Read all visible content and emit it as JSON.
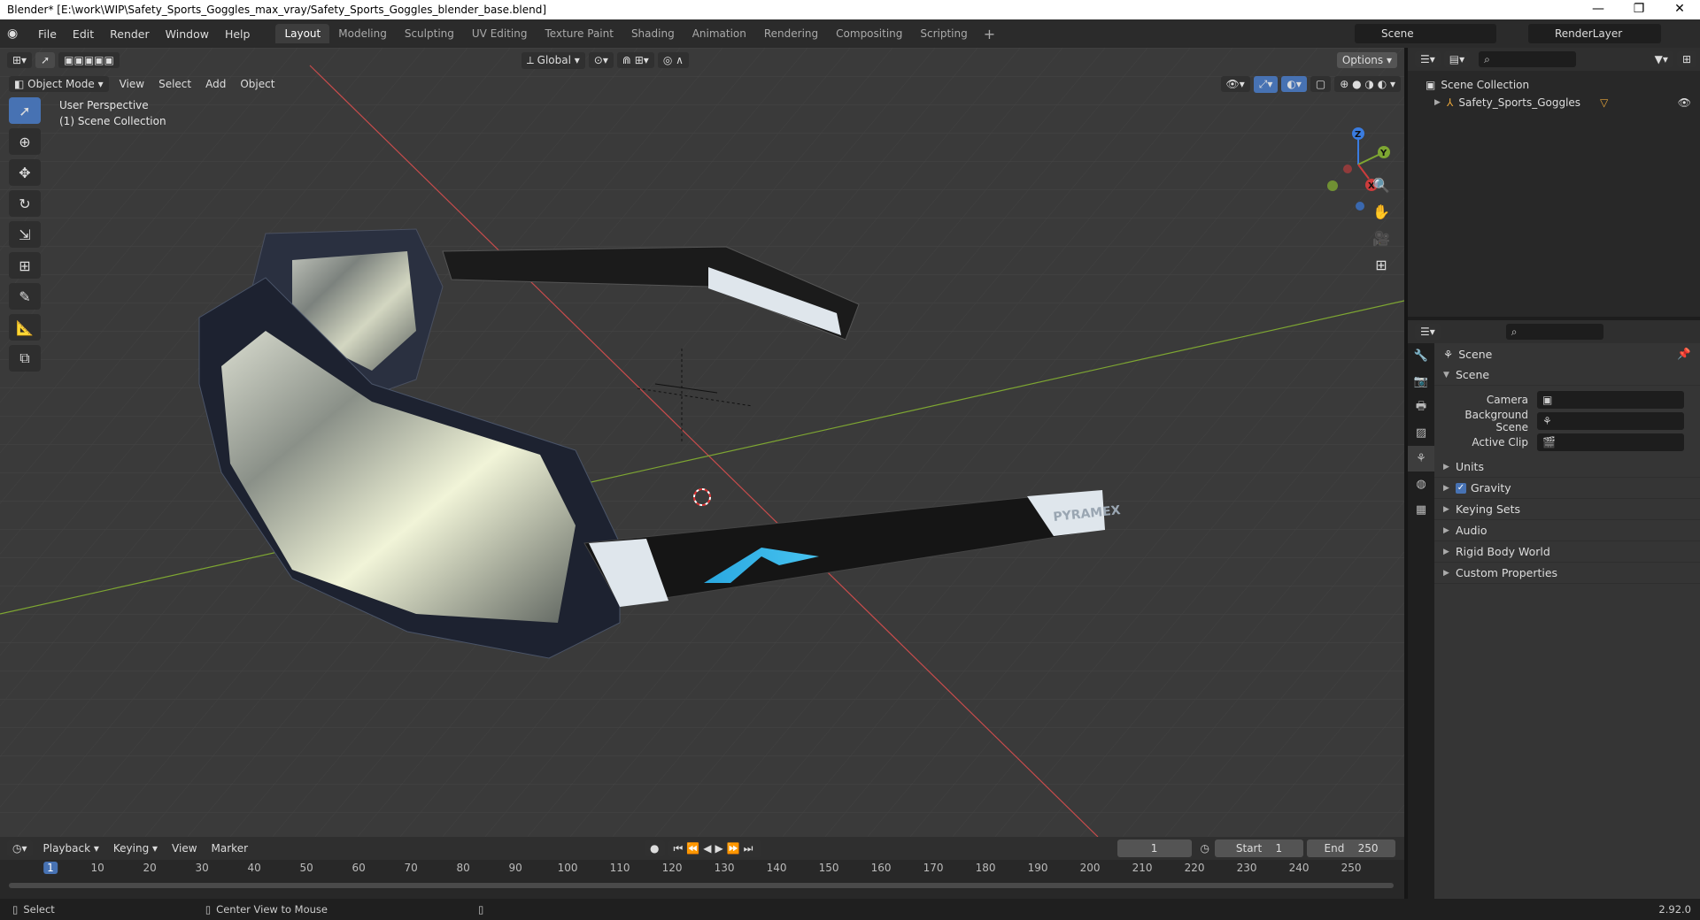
{
  "window": {
    "title": "Blender* [E:\\work\\WIP\\Safety_Sports_Goggles_max_vray/Safety_Sports_Goggles_blender_base.blend]",
    "controls": [
      "—",
      "❐",
      "✕"
    ]
  },
  "topbar": {
    "menus": [
      "File",
      "Edit",
      "Render",
      "Window",
      "Help"
    ],
    "workspaces": [
      "Layout",
      "Modeling",
      "Sculpting",
      "UV Editing",
      "Texture Paint",
      "Shading",
      "Animation",
      "Rendering",
      "Compositing",
      "Scripting"
    ],
    "active_workspace": "Layout",
    "scene_name": "Scene",
    "view_layer": "RenderLayer"
  },
  "viewport": {
    "transform_orientation": "Global",
    "options_label": "Options",
    "mode": "Object Mode",
    "menus": [
      "View",
      "Select",
      "Add",
      "Object"
    ],
    "info_line1": "User Perspective",
    "info_line2": "(1) Scene Collection",
    "brand_text": "PYRAMEX",
    "gizmo": {
      "x": "X",
      "y": "Y",
      "z": "Z"
    }
  },
  "outliner": {
    "root": "Scene Collection",
    "items": [
      {
        "name": "Safety_Sports_Goggles"
      }
    ]
  },
  "properties": {
    "context": "Scene",
    "section": "Scene",
    "fields": [
      {
        "label": "Camera",
        "value": ""
      },
      {
        "label": "Background Scene",
        "value": ""
      },
      {
        "label": "Active Clip",
        "value": ""
      }
    ],
    "panels": [
      "Units",
      "Gravity",
      "Keying Sets",
      "Audio",
      "Rigid Body World",
      "Custom Properties"
    ],
    "gravity_checked": true
  },
  "timeline": {
    "menus": [
      "Playback",
      "Keying",
      "View",
      "Marker"
    ],
    "current_frame": "1",
    "start_label": "Start",
    "start": "1",
    "end_label": "End",
    "end": "250",
    "ruler": [
      "1",
      "10",
      "20",
      "30",
      "40",
      "50",
      "60",
      "70",
      "80",
      "90",
      "100",
      "110",
      "120",
      "130",
      "140",
      "150",
      "160",
      "170",
      "180",
      "190",
      "200",
      "210",
      "220",
      "230",
      "240",
      "250"
    ]
  },
  "statusbar": {
    "left": "Select",
    "middle": "Center View to Mouse",
    "version": "2.92.0"
  },
  "colors": {
    "accent": "#4772b3",
    "x_axis": "#cc3c3c",
    "y_axis": "#7ea632",
    "z_axis": "#3a7ce0"
  }
}
